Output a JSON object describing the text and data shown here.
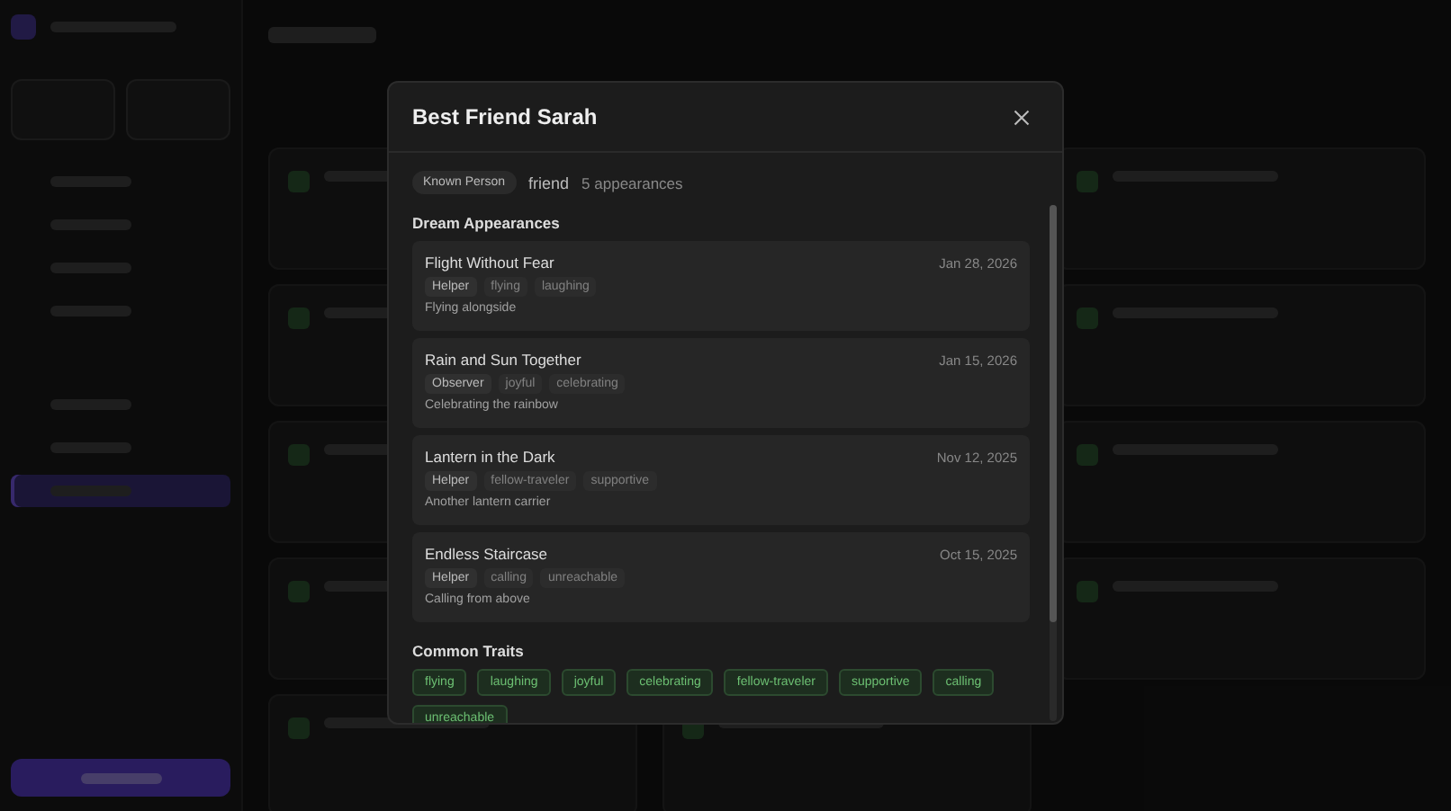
{
  "sidebar_nav": [
    {
      "selected": false
    },
    {
      "selected": false
    },
    {
      "selected": false
    },
    {
      "selected": false
    },
    {
      "selected": false
    },
    {
      "selected": false
    },
    {
      "selected": true
    }
  ],
  "modal": {
    "title": "Best Friend Sarah",
    "category": "Known Person",
    "relationship": "friend",
    "appearances": "5 appearances",
    "section_title": "Dream Appearances",
    "dreams": [
      {
        "title": "Flight Without Fear",
        "date": "Jan 28, 2026",
        "role": "Helper",
        "tags": [
          "flying",
          "laughing"
        ],
        "note": "Flying alongside"
      },
      {
        "title": "Rain and Sun Together",
        "date": "Jan 15, 2026",
        "role": "Observer",
        "tags": [
          "joyful",
          "celebrating"
        ],
        "note": "Celebrating the rainbow"
      },
      {
        "title": "Lantern in the Dark",
        "date": "Nov 12, 2025",
        "role": "Helper",
        "tags": [
          "fellow-traveler",
          "supportive"
        ],
        "note": "Another lantern carrier"
      },
      {
        "title": "Endless Staircase",
        "date": "Oct 15, 2025",
        "role": "Helper",
        "tags": [
          "calling",
          "unreachable"
        ],
        "note": "Calling from above"
      }
    ],
    "traits_title": "Common Traits",
    "traits": [
      "flying",
      "laughing",
      "joyful",
      "celebrating",
      "fellow-traveler",
      "supportive",
      "calling",
      "unreachable"
    ]
  }
}
